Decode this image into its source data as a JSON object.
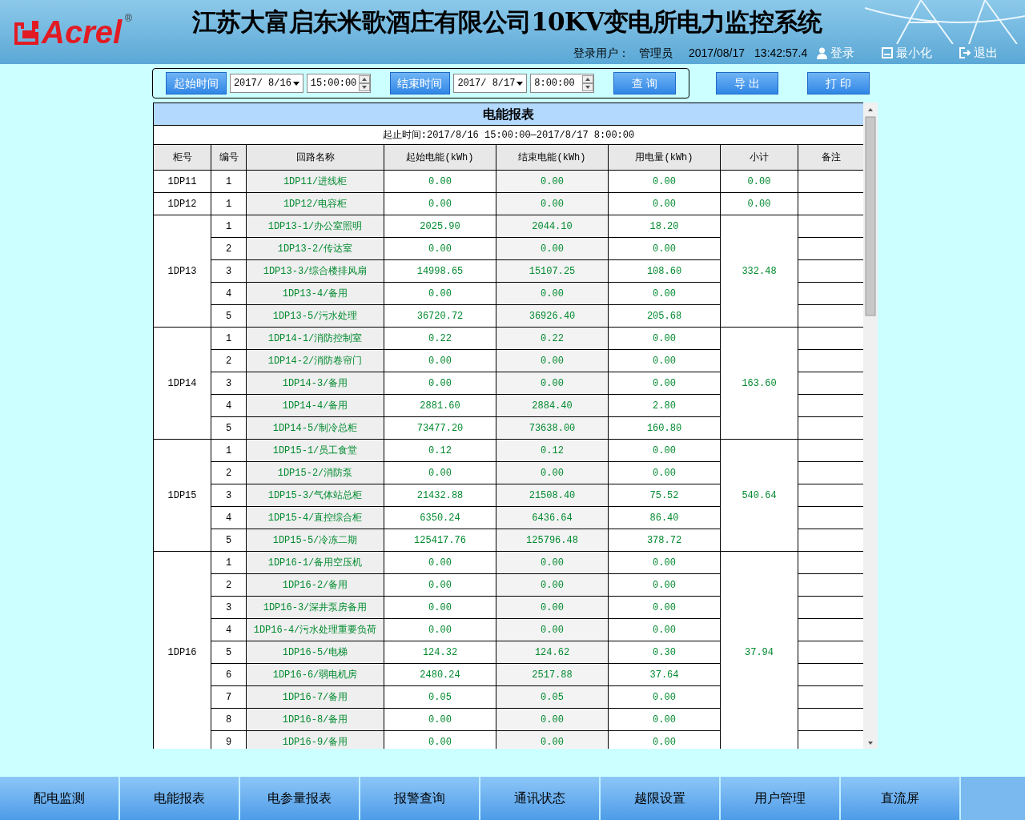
{
  "header": {
    "logo": "Acrel",
    "logo_mark": "®",
    "title": "江苏大富启东米歌酒庄有限公司10KV变电所电力监控系统",
    "user_label": "登录用户：",
    "user": "管理员",
    "date": "2017/08/17",
    "time": "13:42:57.4",
    "actions": [
      "登录",
      "最小化",
      "退出"
    ]
  },
  "query": {
    "start_label": "起始时间",
    "start_date": "2017/ 8/16",
    "start_time": "15:00:00",
    "end_label": "结束时间",
    "end_date": "2017/ 8/17",
    "end_time": "8:00:00",
    "search": "查 询",
    "export": "导 出",
    "print": "打 印"
  },
  "report": {
    "title": "电能报表",
    "period": "起止时间:2017/8/16 15:00:00—2017/8/17 8:00:00",
    "columns": [
      "柜号",
      "编号",
      "回路名称",
      "起始电能(kWh)",
      "结束电能(kWh)",
      "用电量(kWh)",
      "小计",
      "备注"
    ],
    "groups": [
      {
        "cabinet": "1DP11",
        "subtotal": "0.00",
        "rows": [
          {
            "no": "1",
            "name": "1DP11/进线柜",
            "start": "0.00",
            "end": "0.00",
            "usage": "0.00"
          }
        ]
      },
      {
        "cabinet": "1DP12",
        "subtotal": "0.00",
        "rows": [
          {
            "no": "1",
            "name": "1DP12/电容柜",
            "start": "0.00",
            "end": "0.00",
            "usage": "0.00"
          }
        ]
      },
      {
        "cabinet": "1DP13",
        "subtotal": "332.48",
        "rows": [
          {
            "no": "1",
            "name": "1DP13-1/办公室照明",
            "start": "2025.90",
            "end": "2044.10",
            "usage": "18.20"
          },
          {
            "no": "2",
            "name": "1DP13-2/传达室",
            "start": "0.00",
            "end": "0.00",
            "usage": "0.00"
          },
          {
            "no": "3",
            "name": "1DP13-3/综合楼排风扇",
            "start": "14998.65",
            "end": "15107.25",
            "usage": "108.60"
          },
          {
            "no": "4",
            "name": "1DP13-4/备用",
            "start": "0.00",
            "end": "0.00",
            "usage": "0.00"
          },
          {
            "no": "5",
            "name": "1DP13-5/污水处理",
            "start": "36720.72",
            "end": "36926.40",
            "usage": "205.68"
          }
        ]
      },
      {
        "cabinet": "1DP14",
        "subtotal": "163.60",
        "rows": [
          {
            "no": "1",
            "name": "1DP14-1/消防控制室",
            "start": "0.22",
            "end": "0.22",
            "usage": "0.00"
          },
          {
            "no": "2",
            "name": "1DP14-2/消防卷帘门",
            "start": "0.00",
            "end": "0.00",
            "usage": "0.00"
          },
          {
            "no": "3",
            "name": "1DP14-3/备用",
            "start": "0.00",
            "end": "0.00",
            "usage": "0.00"
          },
          {
            "no": "4",
            "name": "1DP14-4/备用",
            "start": "2881.60",
            "end": "2884.40",
            "usage": "2.80"
          },
          {
            "no": "5",
            "name": "1DP14-5/制冷总柜",
            "start": "73477.20",
            "end": "73638.00",
            "usage": "160.80"
          }
        ]
      },
      {
        "cabinet": "1DP15",
        "subtotal": "540.64",
        "rows": [
          {
            "no": "1",
            "name": "1DP15-1/员工食堂",
            "start": "0.12",
            "end": "0.12",
            "usage": "0.00"
          },
          {
            "no": "2",
            "name": "1DP15-2/消防泵",
            "start": "0.00",
            "end": "0.00",
            "usage": "0.00"
          },
          {
            "no": "3",
            "name": "1DP15-3/气体站总柜",
            "start": "21432.88",
            "end": "21508.40",
            "usage": "75.52"
          },
          {
            "no": "4",
            "name": "1DP15-4/直控综合柜",
            "start": "6350.24",
            "end": "6436.64",
            "usage": "86.40"
          },
          {
            "no": "5",
            "name": "1DP15-5/冷冻二期",
            "start": "125417.76",
            "end": "125796.48",
            "usage": "378.72"
          }
        ]
      },
      {
        "cabinet": "1DP16",
        "subtotal": "37.94",
        "rows": [
          {
            "no": "1",
            "name": "1DP16-1/备用空压机",
            "start": "0.00",
            "end": "0.00",
            "usage": "0.00"
          },
          {
            "no": "2",
            "name": "1DP16-2/备用",
            "start": "0.00",
            "end": "0.00",
            "usage": "0.00"
          },
          {
            "no": "3",
            "name": "1DP16-3/深井泵房备用",
            "start": "0.00",
            "end": "0.00",
            "usage": "0.00"
          },
          {
            "no": "4",
            "name": "1DP16-4/污水处理重要负荷",
            "start": "0.00",
            "end": "0.00",
            "usage": "0.00"
          },
          {
            "no": "5",
            "name": "1DP16-5/电梯",
            "start": "124.32",
            "end": "124.62",
            "usage": "0.30"
          },
          {
            "no": "6",
            "name": "1DP16-6/弱电机房",
            "start": "2480.24",
            "end": "2517.88",
            "usage": "37.64"
          },
          {
            "no": "7",
            "name": "1DP16-7/备用",
            "start": "0.05",
            "end": "0.05",
            "usage": "0.00"
          },
          {
            "no": "8",
            "name": "1DP16-8/备用",
            "start": "0.00",
            "end": "0.00",
            "usage": "0.00"
          },
          {
            "no": "9",
            "name": "1DP16-9/备用",
            "start": "0.00",
            "end": "0.00",
            "usage": "0.00"
          }
        ]
      }
    ]
  },
  "nav": [
    {
      "label": "配电监测",
      "selected": false
    },
    {
      "label": "电能报表",
      "selected": false
    },
    {
      "label": "电参量报表",
      "selected": false
    },
    {
      "label": "报警查询",
      "selected": false
    },
    {
      "label": "通讯状态",
      "selected": false
    },
    {
      "label": "越限设置",
      "selected": false
    },
    {
      "label": "用户管理",
      "selected": false
    },
    {
      "label": "直流屏",
      "selected": false
    }
  ]
}
